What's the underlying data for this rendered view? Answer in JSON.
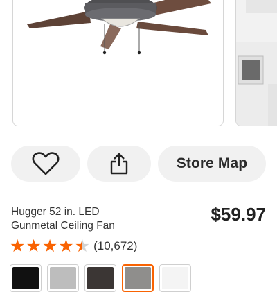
{
  "actions": {
    "favorite_icon": "heart-icon",
    "share_icon": "share-icon",
    "store_map_label": "Store Map"
  },
  "product": {
    "title_line1": "Hugger 52 in. LED",
    "title_line2": "Gunmetal Ceiling Fan",
    "price": "$59.97",
    "rating": 4.5,
    "rating_max": 5,
    "review_count": "(10,672)"
  },
  "swatches": [
    {
      "color": "#111111",
      "selected": false
    },
    {
      "color": "#bdbdbd",
      "selected": false
    },
    {
      "color": "#3b3634",
      "selected": false
    },
    {
      "color": "#8f8e8c",
      "selected": true
    },
    {
      "color": "#f4f4f4",
      "selected": false
    }
  ],
  "colors": {
    "accent": "#f96302",
    "button_bg": "#f1f1f1",
    "star_empty": "#d2d2d2"
  }
}
